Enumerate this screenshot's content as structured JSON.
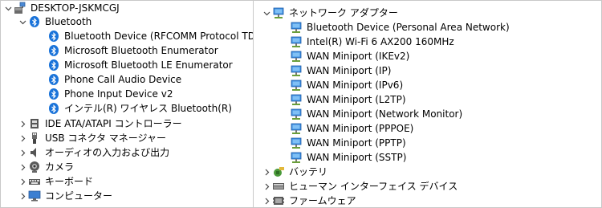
{
  "left_tree": {
    "root": {
      "label": "DESKTOP-JSKMCGJ",
      "icon": "computer-icon"
    },
    "bluetooth": {
      "label": "Bluetooth",
      "icon": "bluetooth-icon",
      "children": [
        "Bluetooth Device (RFCOMM Protocol TDI)",
        "Microsoft Bluetooth Enumerator",
        "Microsoft Bluetooth LE Enumerator",
        "Phone Call Audio Device",
        "Phone Input Device v2",
        "インテル(R) ワイヤレス Bluetooth(R)"
      ]
    },
    "categories": [
      {
        "label": "IDE ATA/ATAPI コントローラー",
        "icon": "ide-controller-icon"
      },
      {
        "label": "USB コネクタ マネージャー",
        "icon": "usb-connector-icon"
      },
      {
        "label": "オーディオの入力および出力",
        "icon": "speaker-icon"
      },
      {
        "label": "カメラ",
        "icon": "camera-icon"
      },
      {
        "label": "キーボード",
        "icon": "keyboard-icon"
      },
      {
        "label": "コンピューター",
        "icon": "monitor-icon"
      }
    ]
  },
  "right_tree": {
    "network": {
      "label": "ネットワーク アダプター",
      "icon": "network-adapter-icon",
      "children": [
        "Bluetooth Device (Personal Area Network)",
        "Intel(R) Wi-Fi 6 AX200 160MHz",
        "WAN Miniport (IKEv2)",
        "WAN Miniport (IP)",
        "WAN Miniport (IPv6)",
        "WAN Miniport (L2TP)",
        "WAN Miniport (Network Monitor)",
        "WAN Miniport (PPPOE)",
        "WAN Miniport (PPTP)",
        "WAN Miniport (SSTP)"
      ]
    },
    "categories": [
      {
        "label": "バッテリ",
        "icon": "battery-icon"
      },
      {
        "label": "ヒューマン インターフェイス デバイス",
        "icon": "hid-icon"
      },
      {
        "label": "ファームウェア",
        "icon": "firmware-icon"
      }
    ]
  }
}
